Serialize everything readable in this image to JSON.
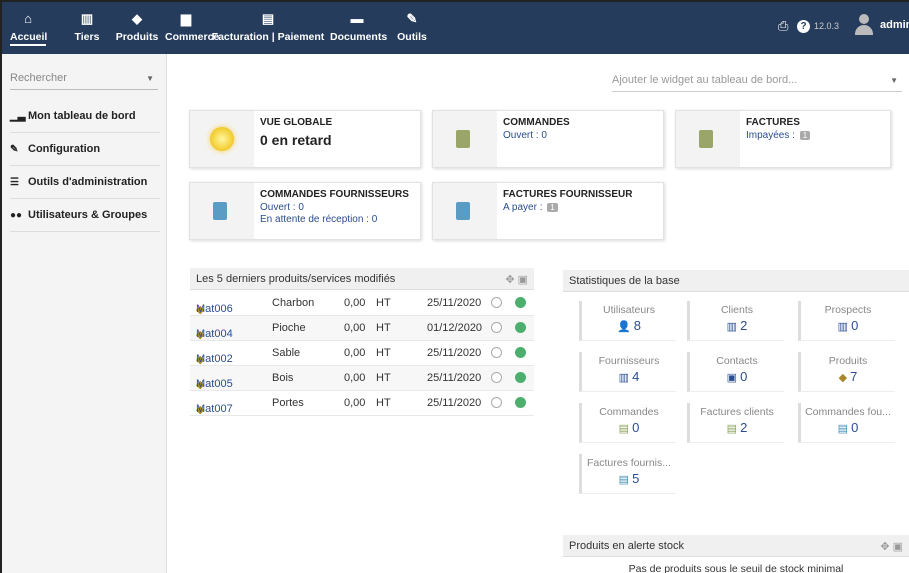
{
  "topbar": {
    "menu": [
      {
        "label": "Accueil",
        "icon": "home-icon",
        "glyph": "⌂"
      },
      {
        "label": "Tiers",
        "icon": "building-icon",
        "glyph": "▥"
      },
      {
        "label": "Produits",
        "icon": "cube-icon",
        "glyph": "◆"
      },
      {
        "label": "Commerce",
        "icon": "briefcase-icon",
        "glyph": "▆"
      },
      {
        "label": "Facturation | Paiement",
        "icon": "money-icon",
        "glyph": "▤"
      },
      {
        "label": "Documents",
        "icon": "folder-icon",
        "glyph": "▬"
      },
      {
        "label": "Outils",
        "icon": "wrench-icon",
        "glyph": "✎"
      }
    ],
    "version": "12.0.3",
    "user": "admin"
  },
  "sidebar": {
    "search_placeholder": "Rechercher",
    "items": [
      {
        "label": "Mon tableau de bord",
        "icon": "chart-icon",
        "glyph": "▁▃"
      },
      {
        "label": "Configuration",
        "icon": "wrench-icon",
        "glyph": "✎"
      },
      {
        "label": "Outils d'administration",
        "icon": "server-icon",
        "glyph": "☰"
      },
      {
        "label": "Utilisateurs & Groupes",
        "icon": "users-icon",
        "glyph": "👥"
      }
    ]
  },
  "widget_selector": "Ajouter le widget au tableau de bord...",
  "boxes": {
    "global": {
      "title": "VUE GLOBALE",
      "value": "0 en retard"
    },
    "commandes": {
      "title": "COMMANDES",
      "line1": "Ouvert : 0"
    },
    "factures": {
      "title": "FACTURES",
      "line1": "Impayées :",
      "badge": "1"
    },
    "cmd_fourn": {
      "title": "COMMANDES FOURNISSEURS",
      "line1": "Ouvert : 0",
      "line2": "En attente de réception : 0"
    },
    "fact_fourn": {
      "title": "FACTURES FOURNISSEUR",
      "line1": "A payer :",
      "badge": "1"
    }
  },
  "products_panel": {
    "title": "Les 5 derniers produits/services modifiés",
    "rows": [
      {
        "ref": "Mat006",
        "label": "Charbon",
        "price": "0,00",
        "tax": "HT",
        "date": "25/11/2020"
      },
      {
        "ref": "Mat004",
        "label": "Pioche",
        "price": "0,00",
        "tax": "HT",
        "date": "01/12/2020"
      },
      {
        "ref": "Mat002",
        "label": "Sable",
        "price": "0,00",
        "tax": "HT",
        "date": "25/11/2020"
      },
      {
        "ref": "Mat005",
        "label": "Bois",
        "price": "0,00",
        "tax": "HT",
        "date": "25/11/2020"
      },
      {
        "ref": "Mat007",
        "label": "Portes",
        "price": "0,00",
        "tax": "HT",
        "date": "25/11/2020"
      }
    ]
  },
  "stats_panel": {
    "title": "Statistiques de la base",
    "items": [
      {
        "label": "Utilisateurs",
        "value": "8",
        "glyph": "👤",
        "color": "#8a6d4a"
      },
      {
        "label": "Clients",
        "value": "2",
        "glyph": "▥",
        "color": "#2a4e8f"
      },
      {
        "label": "Prospects",
        "value": "0",
        "glyph": "▥",
        "color": "#2a4e8f"
      },
      {
        "label": "Fournisseurs",
        "value": "4",
        "glyph": "▥",
        "color": "#2a4e8f"
      },
      {
        "label": "Contacts",
        "value": "0",
        "glyph": "▣",
        "color": "#2a4e8f"
      },
      {
        "label": "Produits",
        "value": "7",
        "glyph": "◆",
        "color": "#a8862b"
      },
      {
        "label": "Commandes",
        "value": "0",
        "glyph": "▤",
        "color": "#8aa05a"
      },
      {
        "label": "Factures clients",
        "value": "2",
        "glyph": "▤",
        "color": "#8aa05a"
      },
      {
        "label": "Commandes fou...",
        "value": "0",
        "glyph": "▤",
        "color": "#3b8fb7"
      },
      {
        "label": "Factures fournis...",
        "value": "5",
        "glyph": "▤",
        "color": "#3b8fb7"
      }
    ]
  },
  "stock_panel": {
    "title": "Produits en alerte stock",
    "message": "Pas de produits sous le seuil de stock minimal"
  }
}
